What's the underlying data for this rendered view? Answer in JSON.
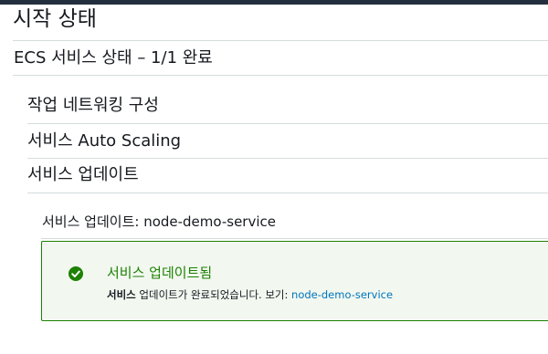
{
  "page": {
    "title": "시작 상태"
  },
  "status_section": {
    "title": "ECS 서비스 상태 – 1/1 완료"
  },
  "steps": [
    {
      "label": "작업 네트워킹 구성"
    },
    {
      "label": "서비스 Auto Scaling"
    },
    {
      "label": "서비스 업데이트"
    }
  ],
  "service_update": {
    "title": "서비스 업데이트: node-demo-service"
  },
  "flash": {
    "title": "서비스 업데이트됨",
    "body_bold": "서비스",
    "body_text": " 업데이트가 완료되었습니다. 보기: ",
    "link": "node-demo-service",
    "icon": "check-circle-icon",
    "color": "#1d8102"
  },
  "colors": {
    "top_bar": "#232f3e",
    "success": "#1d8102",
    "link": "#0073bb"
  }
}
